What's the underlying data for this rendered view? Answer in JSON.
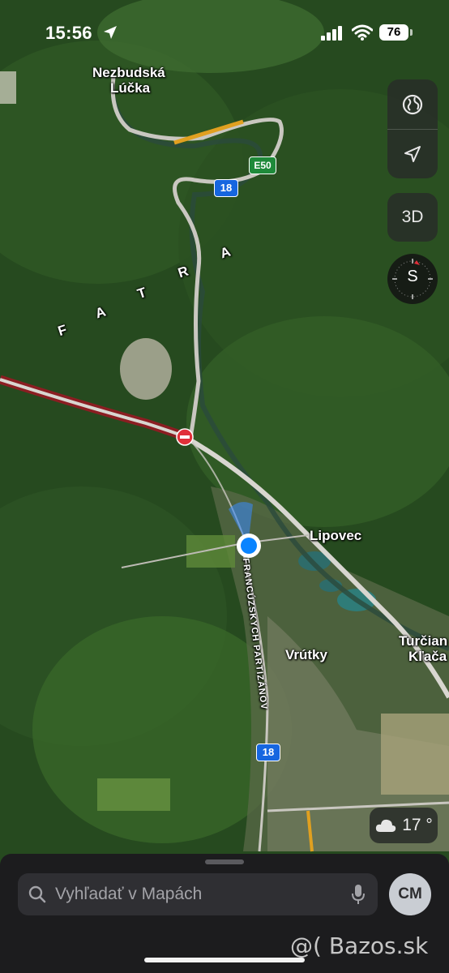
{
  "status_bar": {
    "time": "15:56",
    "battery": "76"
  },
  "map": {
    "labels": {
      "nezbudska": "Nezbudská",
      "lucka": "Lúčka",
      "lipovec": "Lipovec",
      "vrutky": "Vrútky",
      "turcian": "Turčian",
      "klaca": "Kľača",
      "street": "FRANCÚZSKYCH PARTIZÁNOV",
      "fatra_letters": [
        "F",
        "A",
        "T",
        "R",
        "A"
      ]
    },
    "shields": {
      "road18_top": "18",
      "road18_bottom": "18",
      "e50": "E50"
    }
  },
  "controls": {
    "three_d": "3D",
    "compass_letter": "S"
  },
  "weather": {
    "temperature": "17 °"
  },
  "sheet": {
    "search_placeholder": "Vyhľadať v Mapách",
    "avatar_initials": "CM"
  },
  "watermark": "@( Bazos.sk",
  "colors": {
    "route": "#8b1e22",
    "highway": "#d8d6d0",
    "location": "#0a84ff",
    "toll": "#e0a020"
  }
}
